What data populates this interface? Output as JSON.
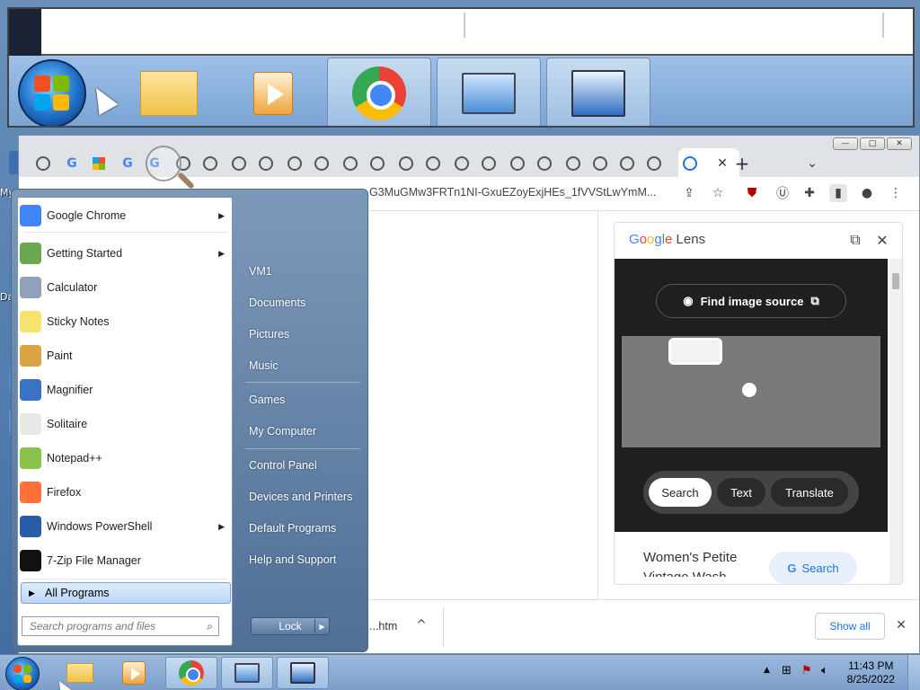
{
  "desktop": {
    "labels": [
      "My",
      "Dat"
    ]
  },
  "browser": {
    "url_text": "G3MuGMw3FRTn1NI-GxuEZoyExjHEs_1fVVStLwYmM...",
    "window_buttons": [
      "—",
      "□",
      "✕"
    ],
    "new_tab": "+",
    "tab_close": "✕",
    "tab_list": "⌄"
  },
  "lens": {
    "title_parts": [
      "G",
      "o",
      "o",
      "g",
      "l",
      "e",
      " Lens"
    ],
    "find_image_source": "Find image source",
    "modes": [
      "Search",
      "Text",
      "Translate"
    ],
    "result_title": "Women's Petite",
    "result_subtitle": "Vintage Wash",
    "search_button": "Search",
    "open_icon": "⧉",
    "close_icon": "✕"
  },
  "downloads": {
    "file_name": "...htm",
    "show_all": "Show all",
    "close": "✕",
    "chevron": "^"
  },
  "start_menu": {
    "programs": [
      {
        "label": "Google Chrome",
        "icon": "chrome-icon",
        "color": "#4285f4",
        "has_arrow": true
      },
      {
        "label": "Getting Started",
        "icon": "getting-started-icon",
        "color": "#6aa84f",
        "has_arrow": true
      },
      {
        "label": "Calculator",
        "icon": "calculator-icon",
        "color": "#8fa3b8",
        "has_arrow": false
      },
      {
        "label": "Sticky Notes",
        "icon": "sticky-notes-icon",
        "color": "#f7e26b",
        "has_arrow": false
      },
      {
        "label": "Paint",
        "icon": "paint-icon",
        "color": "#d9a441",
        "has_arrow": false
      },
      {
        "label": "Magnifier",
        "icon": "magnifier-icon",
        "color": "#3b73c4",
        "has_arrow": false
      },
      {
        "label": "Solitaire",
        "icon": "solitaire-icon",
        "color": "#e8e8e8",
        "has_arrow": false
      },
      {
        "label": "Notepad++",
        "icon": "notepadpp-icon",
        "color": "#8bc34a",
        "has_arrow": false
      },
      {
        "label": "Firefox",
        "icon": "firefox-icon",
        "color": "#ff7139",
        "has_arrow": false
      },
      {
        "label": "Windows PowerShell",
        "icon": "powershell-icon",
        "color": "#2a5da8",
        "has_arrow": true
      },
      {
        "label": "7-Zip File Manager",
        "icon": "7zip-icon",
        "color": "#111111",
        "has_arrow": false
      }
    ],
    "all_programs": "All Programs",
    "search_placeholder": "Search programs and files",
    "right_links": [
      "VM1",
      "Documents",
      "Pictures",
      "Music",
      "Games",
      "My Computer",
      "Control Panel",
      "Devices and Printers",
      "Default Programs",
      "Help and Support"
    ],
    "lock_label": "Lock"
  },
  "taskbar": {
    "time": "11:43 PM",
    "date": "8/25/2022"
  }
}
